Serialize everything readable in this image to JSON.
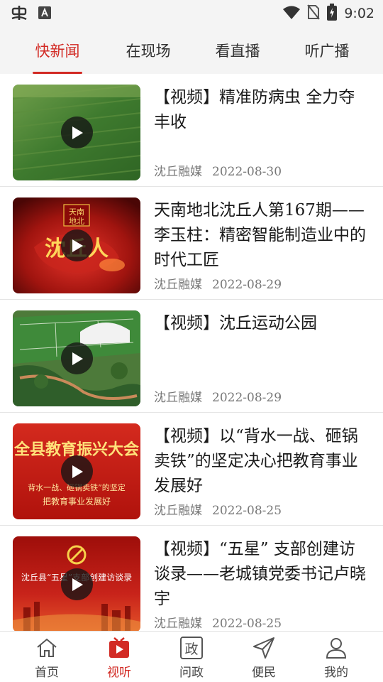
{
  "status_bar": {
    "time": "9:02"
  },
  "tabs": [
    {
      "label": "快新闻",
      "active": true
    },
    {
      "label": "在现场",
      "active": false
    },
    {
      "label": "看直播",
      "active": false
    },
    {
      "label": "听广播",
      "active": false
    }
  ],
  "news": [
    {
      "title": "【视频】精准防病虫 全力夺丰收",
      "source": "沈丘融媒",
      "date": "2022-08-30"
    },
    {
      "title": "天南地北沈丘人第167期——李玉柱：精密智能制造业中的时代工匠",
      "source": "沈丘融媒",
      "date": "2022-08-29",
      "thumb_text": [
        "天南",
        "地北",
        "沈丘人"
      ]
    },
    {
      "title": "【视频】沈丘运动公园",
      "source": "沈丘融媒",
      "date": "2022-08-29"
    },
    {
      "title": "【视频】以“背水一战、砸锅卖铁”的坚定决心把教育事业发展好",
      "source": "沈丘融媒",
      "date": "2022-08-25",
      "thumb_text": [
        "全县教育振兴大会",
        "背水一战、砸锅卖铁”的坚定",
        "把教育事业发展好"
      ]
    },
    {
      "title": "【视频】“五星” 支部创建访谈录——老城镇党委书记卢晓宇",
      "source": "沈丘融媒",
      "date": "2022-08-25",
      "thumb_text": [
        "沈丘县“五星”支部创建访谈录"
      ]
    }
  ],
  "bottom_nav": [
    {
      "label": "首页",
      "icon": "home-icon",
      "active": false
    },
    {
      "label": "视听",
      "icon": "video-icon",
      "active": true
    },
    {
      "label": "问政",
      "icon": "politics-icon",
      "active": false,
      "icon_text": "政"
    },
    {
      "label": "便民",
      "icon": "send-icon",
      "active": false
    },
    {
      "label": "我的",
      "icon": "user-icon",
      "active": false
    }
  ],
  "colors": {
    "accent": "#d22a24",
    "text": "#1a1a1a",
    "meta": "#777777",
    "bar_bg": "#f4f4f4"
  }
}
